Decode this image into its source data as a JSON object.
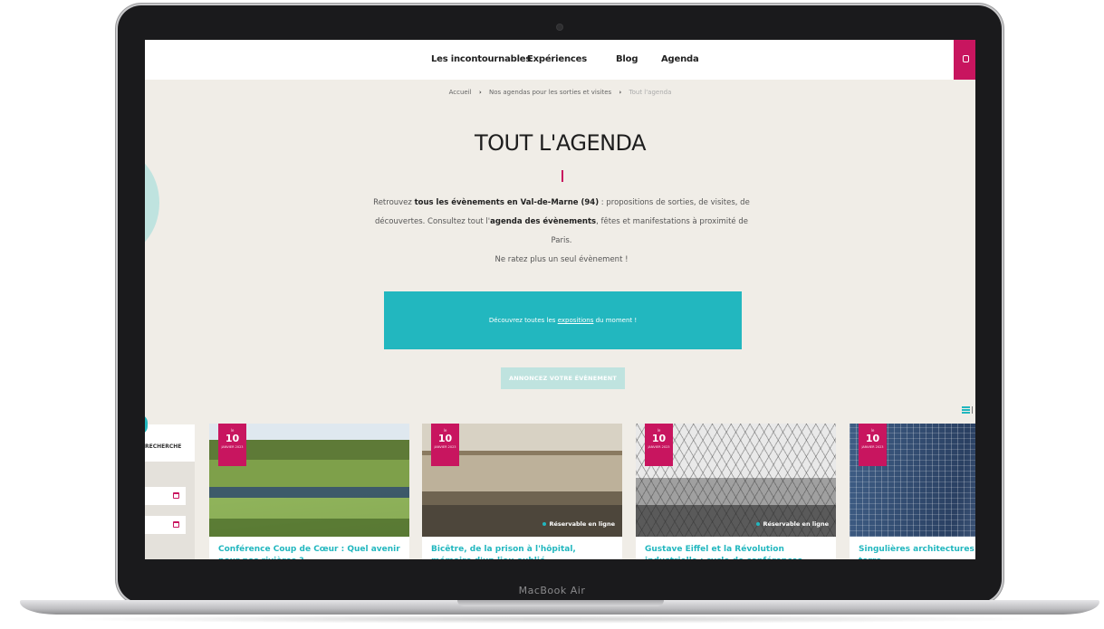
{
  "device": {
    "label": "MacBook Air"
  },
  "nav": {
    "items": [
      "Les incontournables",
      "Expériences",
      "Blog",
      "Agenda"
    ]
  },
  "breadcrumb": {
    "home": "Accueil",
    "sep": "›",
    "parent": "Nos agendas pour les sorties et visites",
    "current": "Tout l'agenda"
  },
  "page": {
    "title": "TOUT L'AGENDA",
    "intro": {
      "p1_a": "Retrouvez ",
      "p1_b": "tous les évènements en Val-de-Marne (94)",
      "p1_c": " : propositions de sorties, de visites, de découvertes. Consultez tout l'",
      "p1_d": "agenda des évènements",
      "p1_e": ", fêtes et manifestations à proximité de Paris.",
      "p2": "Ne ratez plus un seul évènement !"
    }
  },
  "banner": {
    "text_a": "Découvrez toutes les ",
    "link": "expositions",
    "text_b": " du moment !"
  },
  "announce_button": "ANNONCEZ VOTRE ÉVÈNEMENT",
  "search": {
    "label": "RECHERCHE"
  },
  "events": [
    {
      "day_name": "le",
      "day": "10",
      "month": "JANVIER 2023",
      "reservable": "",
      "title": "Conférence Coup de Cœur : Quel avenir pour nos rivières ?"
    },
    {
      "day_name": "le",
      "day": "10",
      "month": "JANVIER 2023",
      "reservable": "Réservable en ligne",
      "title": "Bicêtre, de la prison à l'hôpital, mémoire d'un lieu oublié"
    },
    {
      "day_name": "le",
      "day": "10",
      "month": "JANVIER 2023",
      "reservable": "Réservable en ligne",
      "title": "Gustave Eiffel et la Révolution industrielle : cycle de conférences"
    },
    {
      "day_name": "le",
      "day": "10",
      "month": "JANVIER 2023",
      "reservable": "",
      "title": "Singulières architectures entre ciel et terre"
    }
  ],
  "colors": {
    "accent_pink": "#c8155f",
    "accent_teal": "#22b7bf",
    "page_bg": "#f0ede7"
  }
}
